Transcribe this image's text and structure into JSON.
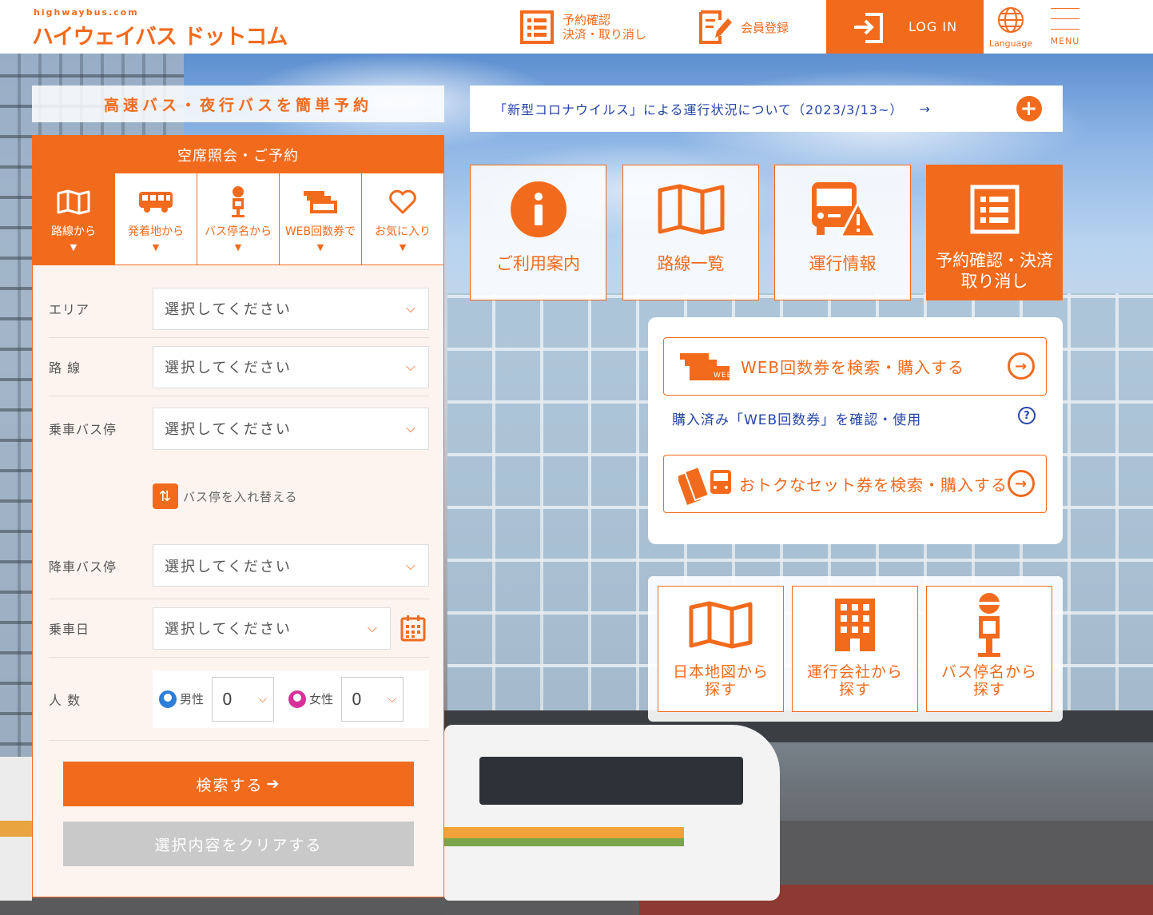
{
  "header": {
    "logo_sub": "highwaybus.com",
    "logo_main": "ハイウェイバス ドットコム",
    "reserve_line1": "予約確認",
    "reserve_line2": "決済・取り消し",
    "member_label": "会員登録",
    "login_label": "LOG IN",
    "language_label": "Language",
    "menu_label": "MENU"
  },
  "tagline": "高速バス・夜行バスを簡単予約",
  "search": {
    "title": "空席照会・ご予約",
    "tabs": [
      {
        "label": "路線から",
        "icon": "map-icon"
      },
      {
        "label": "発着地から",
        "icon": "bus-icon"
      },
      {
        "label": "バス停名から",
        "icon": "bus-stop-icon"
      },
      {
        "label": "WEB回数券で",
        "icon": "ticket-icon"
      },
      {
        "label": "お気に入り",
        "icon": "heart-icon"
      }
    ],
    "tab_arrow": "▼",
    "fields": {
      "area_label": "エリア",
      "route_label": "路 線",
      "board_label": "乗車バス停",
      "alight_label": "降車バス停",
      "date_label": "乗車日",
      "people_label": "人 数",
      "placeholder": "選択してください"
    },
    "swap_label": "バス停を入れ替える",
    "male_label": "男性",
    "female_label": "女性",
    "male_count": "0",
    "female_count": "0",
    "search_button": "検索する",
    "clear_button": "選択内容をクリアする"
  },
  "notice": {
    "text": "「新型コロナウイルス」による運行状況について（2023/3/13~）",
    "arrow": "→",
    "plus": "+"
  },
  "tiles": [
    {
      "label_line1": "ご利用案内",
      "label_line2": "",
      "icon": "info-icon"
    },
    {
      "label_line1": "路線一覧",
      "label_line2": "",
      "icon": "map-icon"
    },
    {
      "label_line1": "運行情報",
      "label_line2": "",
      "icon": "bus-warning-icon"
    },
    {
      "label_line1": "予約確認・決済",
      "label_line2": "取り消し",
      "icon": "list-icon"
    }
  ],
  "web_tickets": {
    "buy_label": "WEB回数券を検索・購入する",
    "purchased_link": "購入済み「WEB回数券」を確認・使用",
    "help": "?",
    "set_label": "おトクなセット券を検索・購入する"
  },
  "search_cards": [
    {
      "line1": "日本地図から",
      "line2": "探す",
      "icon": "japan-map-icon"
    },
    {
      "line1": "運行会社から",
      "line2": "探す",
      "icon": "building-icon"
    },
    {
      "line1": "バス停名から",
      "line2": "探す",
      "icon": "bus-stop-icon"
    }
  ],
  "colors": {
    "accent": "#f26b1d",
    "link": "#2545a8",
    "clear_button": "#c9c9c9"
  }
}
